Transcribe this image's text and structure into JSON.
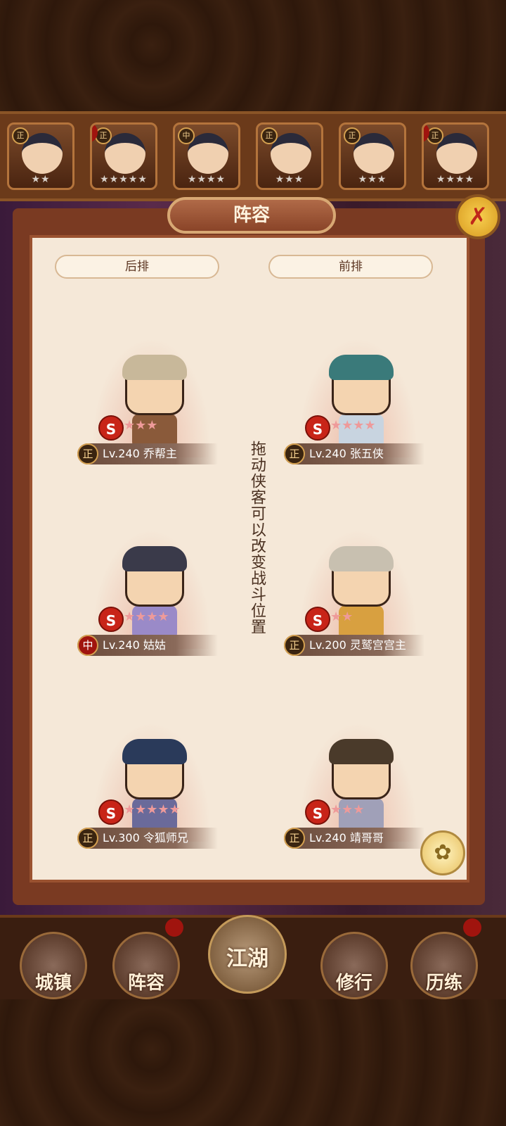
{
  "hero_strip": [
    {
      "tag": "正",
      "stars": "★★"
    },
    {
      "tag": "正",
      "stars": "★★★★★"
    },
    {
      "tag": "中",
      "stars": "★★★★"
    },
    {
      "tag": "正",
      "stars": "★★★"
    },
    {
      "tag": "正",
      "stars": "★★★"
    },
    {
      "tag": "正",
      "stars": "★★★★"
    }
  ],
  "panel": {
    "title": "阵容",
    "close_icon": "✗",
    "rear_label": "后排",
    "front_label": "前排",
    "hint": "拖动侠客可以改变战斗位置",
    "swirl_icon": "✿"
  },
  "rear": [
    {
      "faction": "正",
      "level_name": "Lv.240 乔帮主",
      "stars": "★★★"
    },
    {
      "faction": "中",
      "level_name": "Lv.240 姑姑",
      "stars": "★★★★"
    },
    {
      "faction": "正",
      "level_name": "Lv.300 令狐师兄",
      "stars": "★★★★★"
    }
  ],
  "front": [
    {
      "faction": "正",
      "level_name": "Lv.240 张五侠",
      "stars": "★★★★"
    },
    {
      "faction": "正",
      "level_name": "Lv.200 灵鹫宫宫主",
      "stars": "★★"
    },
    {
      "faction": "正",
      "level_name": "Lv.240 靖哥哥",
      "stars": "★★★"
    }
  ],
  "s_badge": "S",
  "nav": {
    "town": "城镇",
    "lineup": "阵容",
    "jianghu": "江湖",
    "training": "修行",
    "experience": "历练"
  }
}
